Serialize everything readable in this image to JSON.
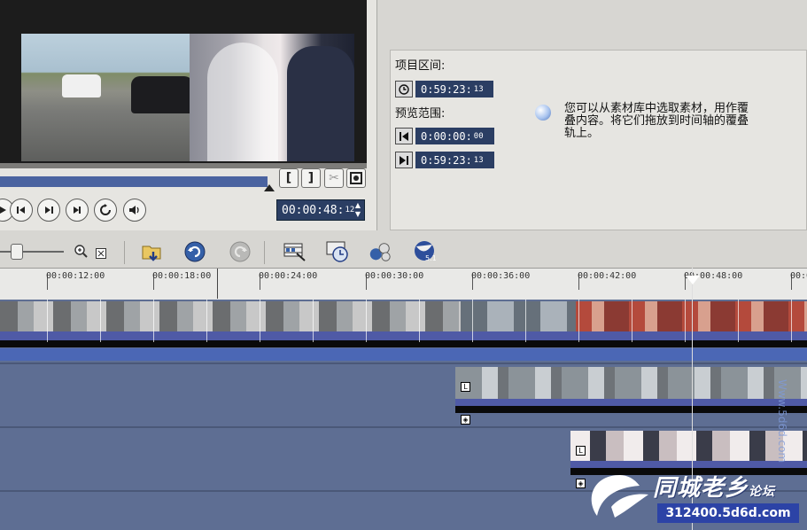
{
  "preview": {
    "timecode_main": "00:00:48:",
    "timecode_frames": "12",
    "buttons": {
      "mark_in": "[",
      "mark_out": "]",
      "cut": "✂",
      "fullscreen": "⤢"
    },
    "playback_position": 0.33
  },
  "info_panel": {
    "project_range_label": "项目区间:",
    "project_duration_main": "0:59:23:",
    "project_duration_frames": "13",
    "preview_range_label": "预览范围:",
    "preview_start_main": "0:00:00:",
    "preview_start_frames": "00",
    "preview_end_main": "0:59:23:",
    "preview_end_frames": "13",
    "hint_text": "您可以从素材库中选取素材，用作覆叠内容。将它们拖放到时间轴的覆叠轨上。"
  },
  "timeline": {
    "ruler_labels": [
      "00:00:12:00",
      "00:00:18:00",
      "00:00:24:00",
      "00:00:30:00",
      "00:00:36:00",
      "00:00:42:00",
      "00:00:48:00",
      "00:0"
    ]
  },
  "watermark": {
    "title": "同城老乡",
    "subtitle": "论坛",
    "url": "312400.5d6d.com",
    "vertical": "Www.5d6d.com"
  },
  "icons": {
    "project_range": "clock-icon",
    "preview_start": "mark-in-icon",
    "preview_end": "mark-out-icon",
    "hint": "bulb-icon"
  },
  "colors": {
    "timecode_bg": "#2b3e63",
    "timeline_bg": "#5e6e93",
    "progress": "#4a63a0"
  }
}
